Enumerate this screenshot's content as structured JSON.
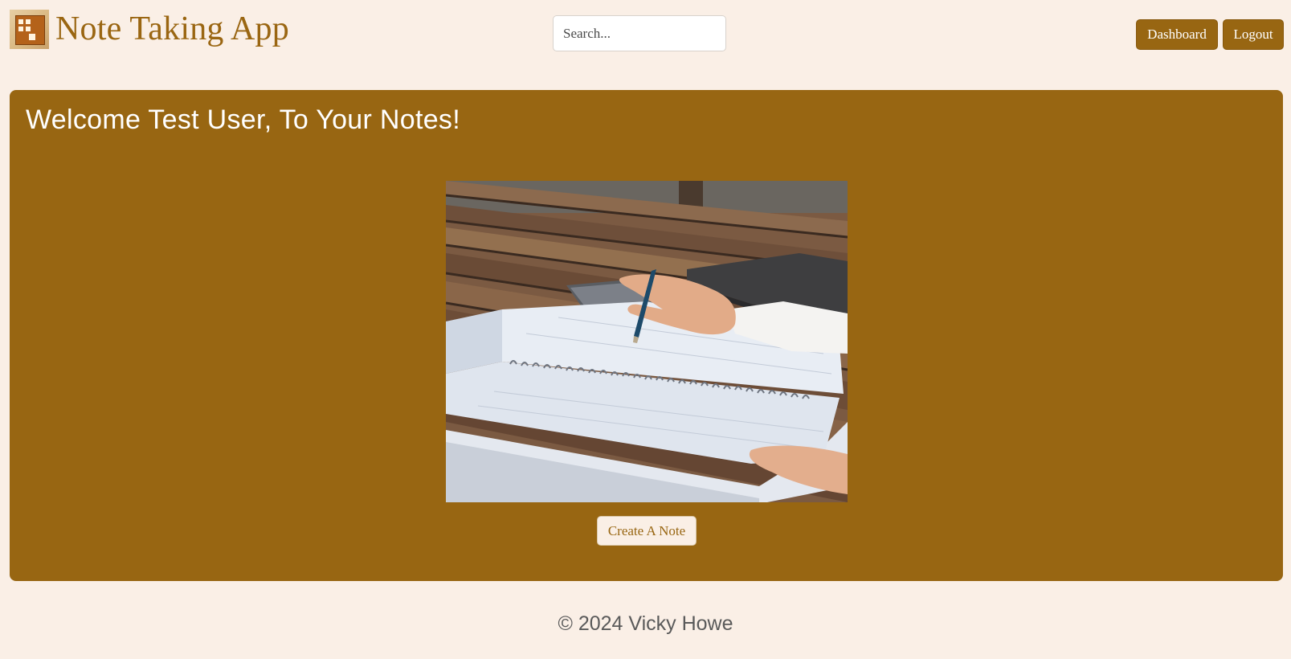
{
  "header": {
    "brand": "Note Taking App",
    "logo_icon": "notes-board-icon",
    "search": {
      "placeholder": "Search..."
    },
    "nav": {
      "dashboard_label": "Dashboard",
      "logout_label": "Logout"
    }
  },
  "main": {
    "welcome": "Welcome Test User, To Your Notes!",
    "hero_image": "hand-writing-in-planner-photo",
    "create_label": "Create A Note"
  },
  "footer": {
    "copyright": "© 2024 Vicky Howe"
  },
  "colors": {
    "background": "#faefe6",
    "accent": "#986612",
    "text_on_accent": "#ffffff"
  }
}
